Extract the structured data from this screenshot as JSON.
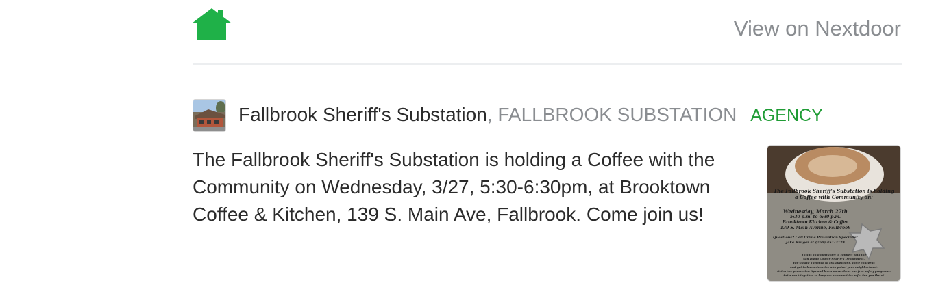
{
  "header": {
    "view_link": "View on Nextdoor",
    "logo_icon": "nextdoor-house-icon",
    "brand_color": "#1fb148"
  },
  "post": {
    "author_name": "Fallbrook Sheriff's Substation",
    "separator": ",",
    "organization": "FALLBROOK SUBSTATION",
    "badge": "AGENCY",
    "badge_color": "#1f9c35",
    "body": "The Fallbrook Sheriff's Substation is holding a Coffee with the Community on Wednesday, 3/27, 5:30-6:30pm, at Brooktown Coffee & Kitchen, 139 S. Main Ave, Fallbrook. Come join us!",
    "avatar_icon": "substation-building-photo",
    "image": {
      "icon": "coffee-flyer-image",
      "headline": "The Fallbrook Sheriff's Substation is holding a Coffee with Community on:",
      "date": "Wednesday, March 27th",
      "time": "5:30 p.m. to 6:30 p.m.",
      "venue": "Brooktown Kitchen & Coffee",
      "address": "139 S. Main Avenue, Fallbrook",
      "questions": "Questions? Call Crime Prevention Specialist",
      "contact": "Jake Kruger at (760) 451-3124",
      "footer_1": "This is an opportunity to connect with the",
      "footer_2": "San Diego County Sheriff's Department.",
      "footer_3": "You'll have a chance to ask questions, voice concerns",
      "footer_4": "and get to know deputies who patrol your neighborhood.",
      "footer_5": "Get crime prevention tips and learn more about our free safety programs.",
      "footer_6": "Let's work together to keep our communities safe. See you there!"
    }
  }
}
